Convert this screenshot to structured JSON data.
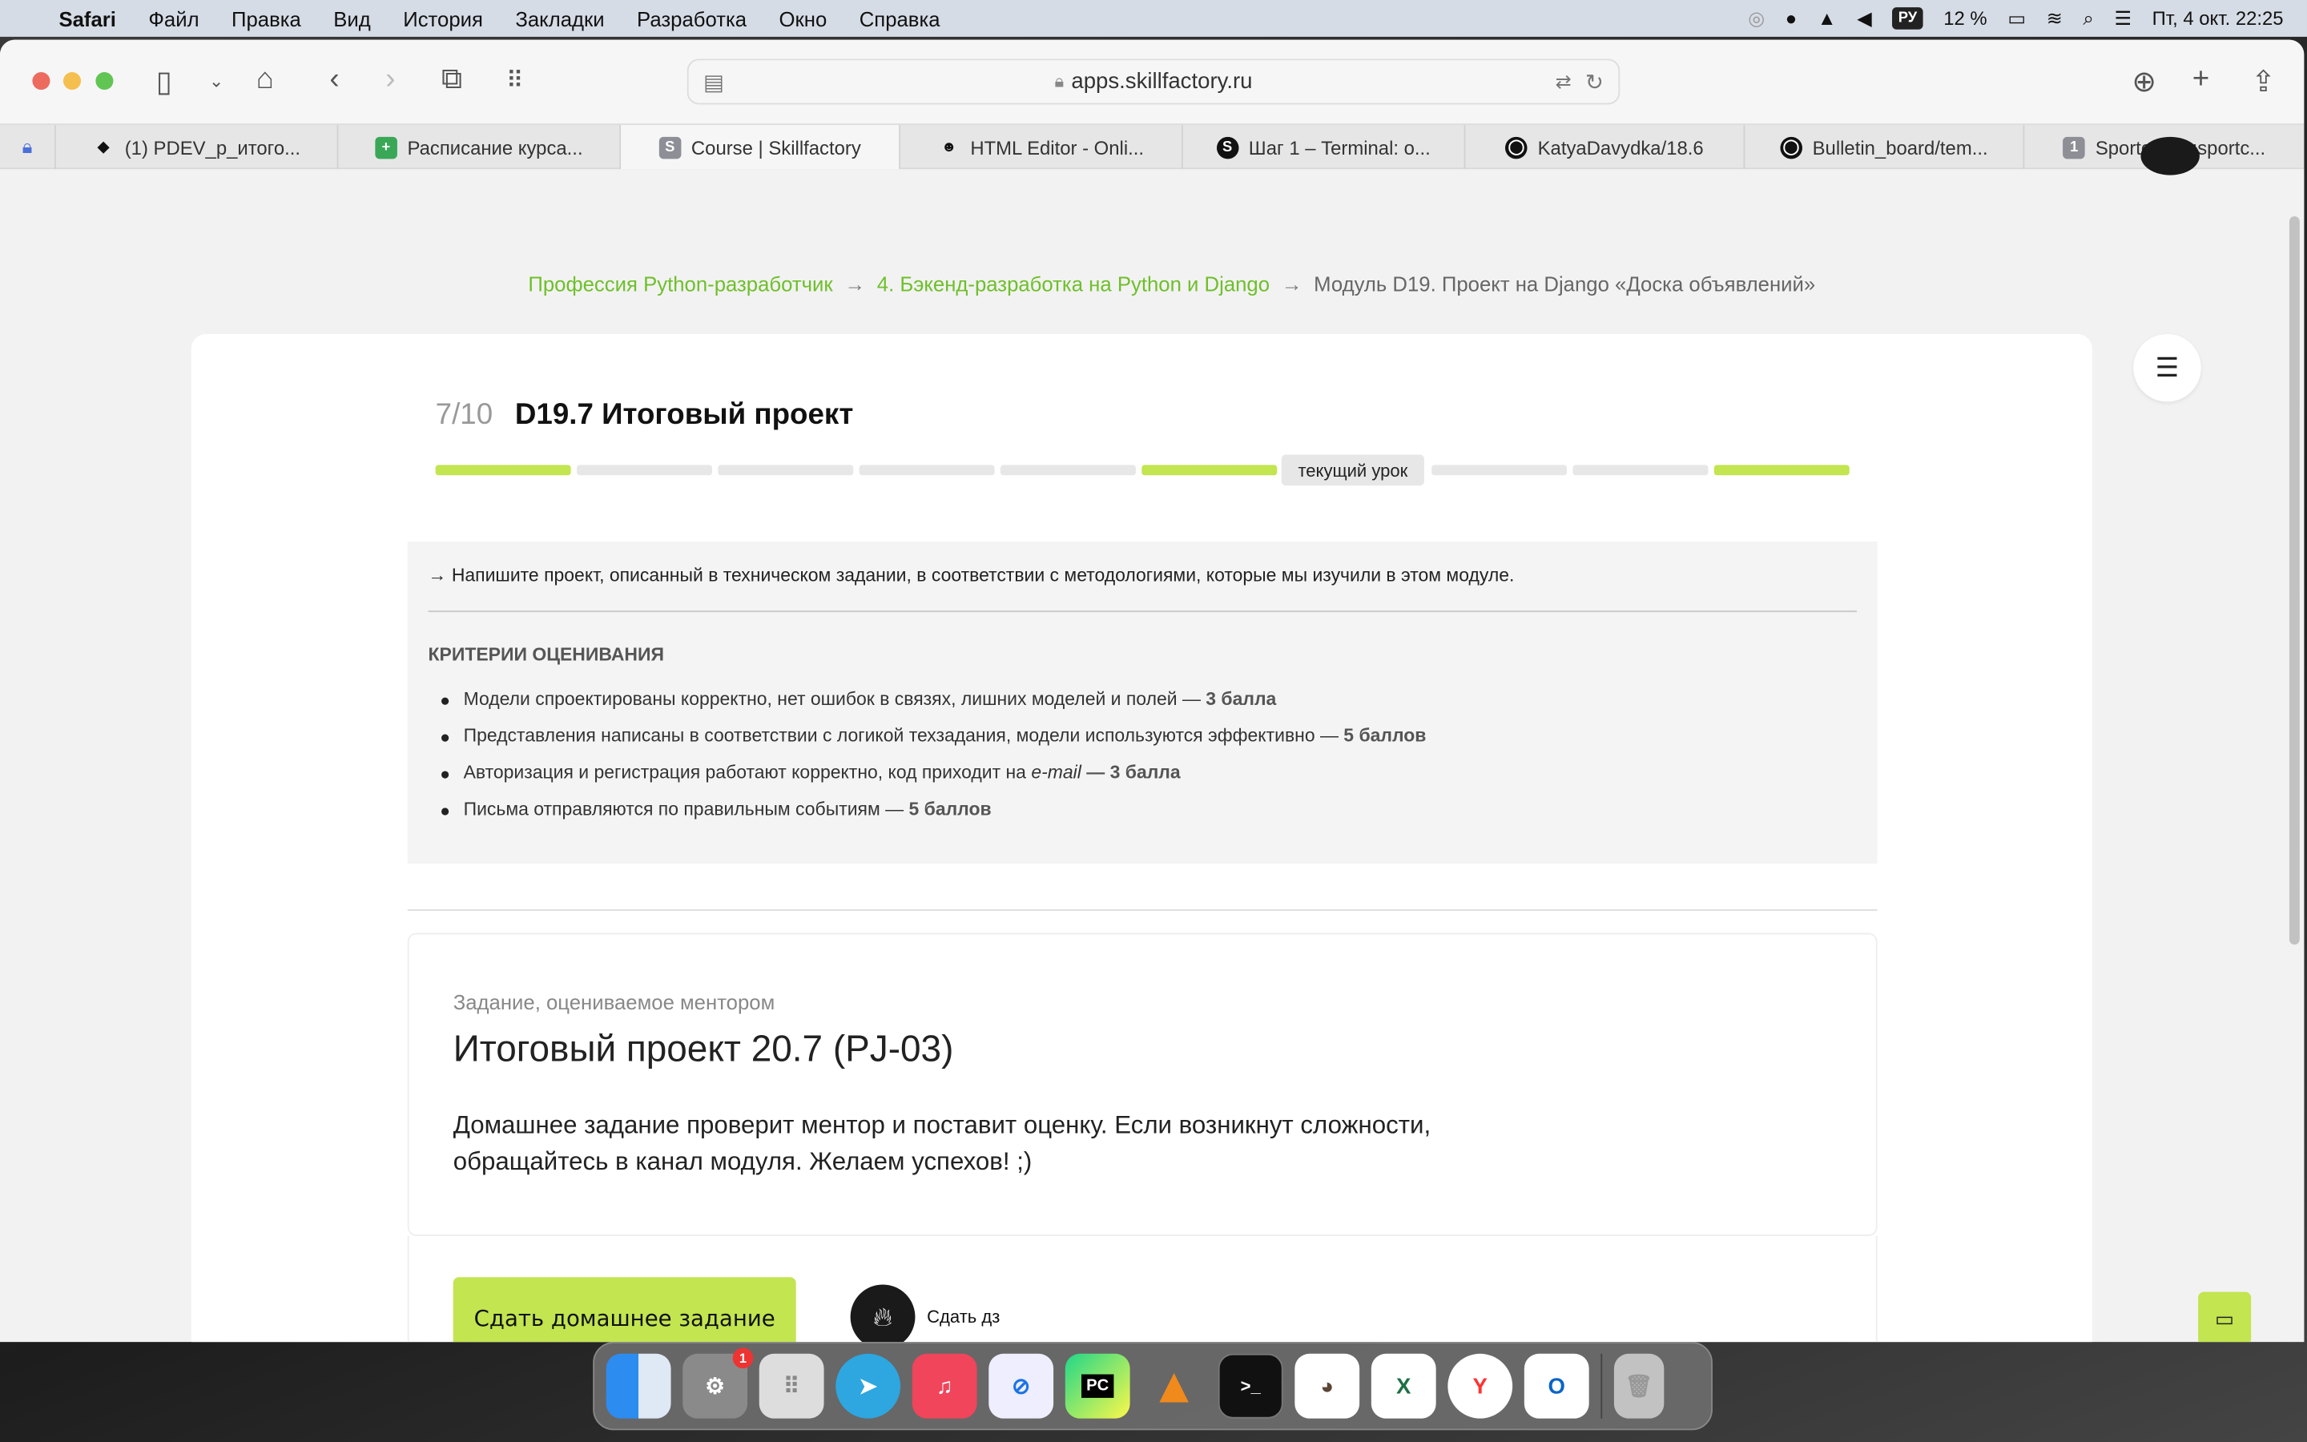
{
  "menubar": {
    "app": "Safari",
    "items": [
      "Файл",
      "Правка",
      "Вид",
      "История",
      "Закладки",
      "Разработка",
      "Окно",
      "Справка"
    ],
    "input_source": "РУ",
    "battery": "12 %",
    "datetime": "Пт, 4 окт.  22:25"
  },
  "browser": {
    "url": "apps.skillfactory.ru",
    "tabs": [
      {
        "label": "(1) PDEV_p_итого...",
        "icon": "layers-icon"
      },
      {
        "label": "Расписание курса...",
        "icon": "sheets-icon"
      },
      {
        "label": "Course | Skillfactory",
        "icon": "s",
        "active": true
      },
      {
        "label": "HTML Editor - Onli...",
        "icon": "hacker-icon"
      },
      {
        "label": "Шаг 1 – Terminal: o...",
        "icon": "s-logo-icon"
      },
      {
        "label": "KatyaDavydka/18.6",
        "icon": "github-icon"
      },
      {
        "label": "Bulletin_board/tem...",
        "icon": "github-icon"
      },
      {
        "label": "Sportcelary:sportc...",
        "icon": "1"
      }
    ]
  },
  "breadcrumb": [
    "Профессия Python-разработчик",
    "4. Бэкенд-разработка на Python и Django",
    "Модуль D19. Проект на Django «Доска объявлений»"
  ],
  "lesson": {
    "number": "7/10",
    "title": "D19.7 Итоговый проект",
    "current_label": "текущий урок",
    "progress": [
      "done",
      "todo",
      "todo",
      "todo",
      "todo",
      "done",
      "current",
      "todo",
      "todo",
      "done"
    ]
  },
  "assignment": {
    "intro": "→ Напишите проект, описанный в техническом задании, в соответствии с методологиями, которые мы изучили в этом модуле.",
    "criteria_title": "КРИТЕРИИ ОЦЕНИВАНИЯ",
    "criteria": [
      {
        "text": "Модели спроектированы корректно, нет ошибок в связях, лишних моделей и полей — ",
        "points": "3 балла"
      },
      {
        "text": "Представления написаны в соответствии с логикой техзадания, модели используются эффективно — ",
        "points": "5 баллов"
      },
      {
        "text": "Авторизация и регистрация работают корректно, код приходит на ",
        "em": "e-mail",
        "text2": " — ",
        "points": "3 балла"
      },
      {
        "text": "Письма отправляются по правильным событиям — ",
        "points": "5 баллов"
      }
    ]
  },
  "task": {
    "kind": "Задание, оцениваемое ментором",
    "title": "Итоговый проект 20.7 (PJ-03)",
    "description": "Домашнее задание проверит ментор и поставит оценку. Если возникнут сложности, обращайтесь в канал модуля. Желаем успехов! ;)",
    "submit_label": "Сдать домашнее задание",
    "submit_hw_label": "Сдать дз"
  },
  "dock": {
    "apps": [
      "Finder",
      "System Settings",
      "Launchpad",
      "Telegram",
      "Music",
      "Safari",
      "PyCharm",
      "VLC",
      "Terminal",
      "DBeaver",
      "Excel",
      "Yandex",
      "Outlook",
      "Trash"
    ],
    "settings_badge": "1"
  },
  "colors": {
    "accent": "#c2e550",
    "link": "#6fbf2a"
  }
}
